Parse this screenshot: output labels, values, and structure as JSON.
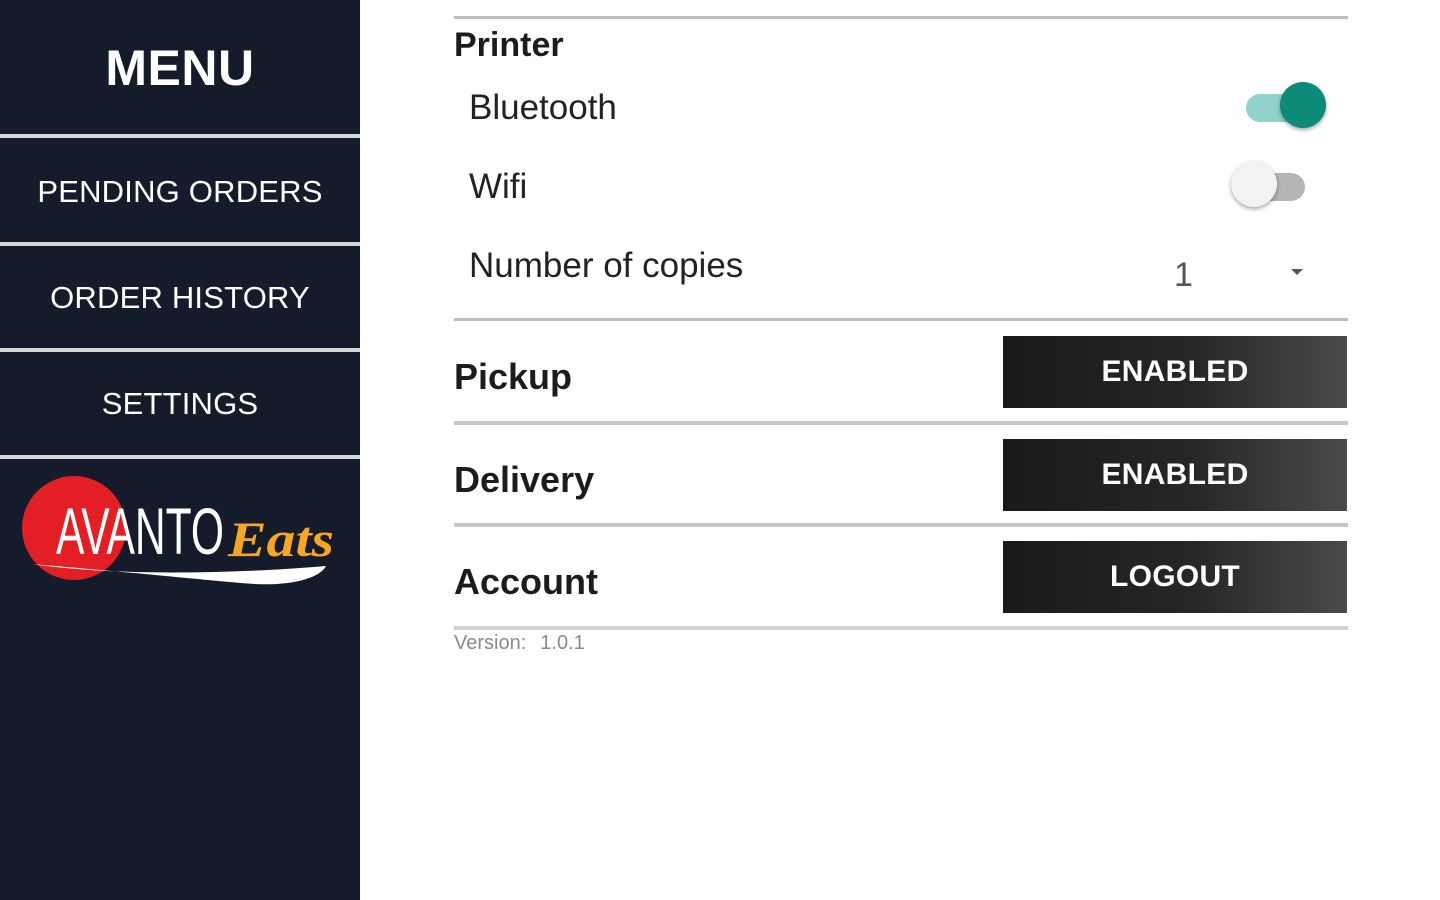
{
  "sidebar": {
    "title": "MENU",
    "items": [
      {
        "label": "PENDING ORDERS"
      },
      {
        "label": "ORDER HISTORY"
      },
      {
        "label": "SETTINGS"
      }
    ],
    "logo": {
      "primary": "AVANTO",
      "secondary": "Eats"
    }
  },
  "settings": {
    "printer": {
      "title": "Printer",
      "bluetooth": {
        "label": "Bluetooth",
        "enabled": true
      },
      "wifi": {
        "label": "Wifi",
        "enabled": false
      },
      "copies": {
        "label": "Number of copies",
        "value": "1"
      }
    },
    "pickup": {
      "label": "Pickup",
      "button": "ENABLED"
    },
    "delivery": {
      "label": "Delivery",
      "button": "ENABLED"
    },
    "account": {
      "label": "Account",
      "button": "LOGOUT"
    },
    "version": {
      "label": "Version:",
      "value": "1.0.1"
    }
  },
  "colors": {
    "sidebar_bg": "#151b2a",
    "toggle_on": "#0e8a78",
    "toggle_on_track": "#8fd3c9",
    "logo_red": "#e31e24",
    "logo_orange": "#f5a623",
    "button_dark": "#1a1a1a"
  },
  "icons": {
    "spinner": "dropdown-arrow-icon"
  }
}
